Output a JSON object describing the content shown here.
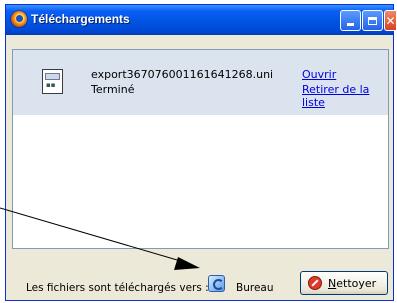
{
  "window": {
    "title": "Téléchargements",
    "icon": "firefox-icon",
    "controls": {
      "minimize": "minimize-icon",
      "maximize": "maximize-icon",
      "close": "close-icon"
    }
  },
  "downloads": [
    {
      "filename": "export367076001161641268.uni",
      "status": "Terminé",
      "icon": "file-icon",
      "actions": {
        "open": "Ouvrir",
        "remove": "Retirer de la liste"
      }
    }
  ],
  "footer": {
    "label": "Les fichiers sont téléchargés vers :",
    "folder_icon": "desktop-folder-icon",
    "folder": "Bureau",
    "clean_button": {
      "underlined": "N",
      "rest": "ettoyer",
      "icon": "stop-icon"
    }
  },
  "colors": {
    "titlebar": "#0054e3",
    "selected_row": "#dbe3ef",
    "link": "#0000e0",
    "window_bg": "#ece9d8"
  }
}
